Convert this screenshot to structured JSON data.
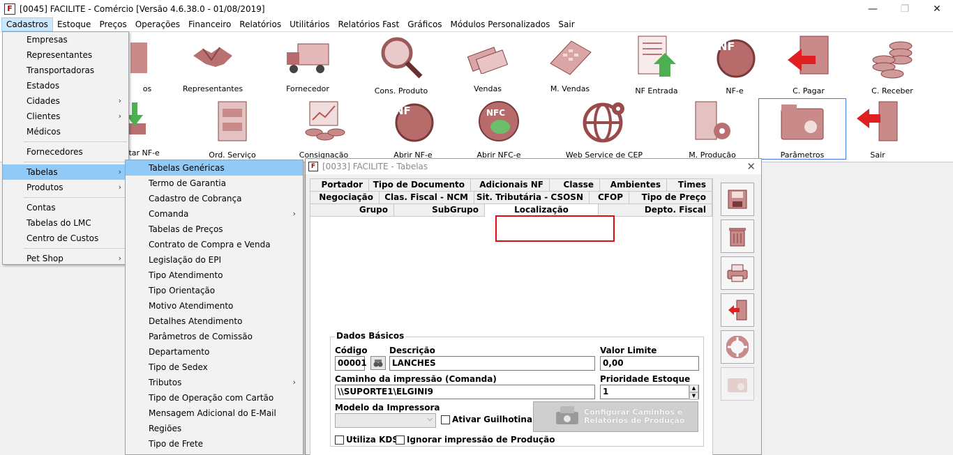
{
  "window": {
    "title": "[0045] FACILITE - Comércio [Versão 4.6.38.0 - 01/08/2019]",
    "app_icon": "F",
    "minimize": "—",
    "maximize": "❐",
    "close": "✕"
  },
  "menubar": [
    "Cadastros",
    "Estoque",
    "Preços",
    "Operações",
    "Financeiro",
    "Relatórios",
    "Utilitários",
    "Relatórios Fast",
    "Gráficos",
    "Módulos Personalizados",
    "Sair"
  ],
  "toolbar": {
    "row1": [
      "os",
      "Representantes",
      "Fornecedor",
      "Cons. Produto",
      "Vendas",
      "M. Vendas",
      "NF Entrada",
      "NF-e",
      "C. Pagar",
      "C. Receber"
    ],
    "row2": [
      "ortar NF-e",
      "Ord. Serviço",
      "Consignação",
      "Abrir NF-e",
      "Abrir NFC-e",
      "Web Service de CEP",
      "M. Produção",
      "Parâmetros",
      "Sair"
    ],
    "nfe_icon_text": "NF",
    "nfce_icon_text": "NFC"
  },
  "cadastros_menu": {
    "items": [
      {
        "label": "Empresas",
        "sub": false
      },
      {
        "label": "Representantes",
        "sub": false
      },
      {
        "label": "Transportadoras",
        "sub": false
      },
      {
        "label": "Estados",
        "sub": false
      },
      {
        "label": "Cidades",
        "sub": true
      },
      {
        "label": "Clientes",
        "sub": true
      },
      {
        "label": "Médicos",
        "sub": false
      },
      {
        "label": "Fornecedores",
        "sub": false
      },
      {
        "label": "Tabelas",
        "sub": true
      },
      {
        "label": "Produtos",
        "sub": true
      },
      {
        "label": "Contas",
        "sub": false
      },
      {
        "label": "Tabelas do LMC",
        "sub": false
      },
      {
        "label": "Centro de Custos",
        "sub": false
      },
      {
        "label": "Pet Shop",
        "sub": true
      }
    ],
    "submenu_arrow": "›"
  },
  "tabelas_menu": {
    "items": [
      {
        "label": "Tabelas Genéricas",
        "sub": false
      },
      {
        "label": "Termo de Garantia",
        "sub": false
      },
      {
        "label": "Cadastro de Cobrança",
        "sub": false
      },
      {
        "label": "Comanda",
        "sub": true
      },
      {
        "label": "Tabelas de Preços",
        "sub": false
      },
      {
        "label": "Contrato de Compra e Venda",
        "sub": false
      },
      {
        "label": "Legislação do EPI",
        "sub": false
      },
      {
        "label": "Tipo Atendimento",
        "sub": false
      },
      {
        "label": "Tipo Orientação",
        "sub": false
      },
      {
        "label": "Motivo Atendimento",
        "sub": false
      },
      {
        "label": "Detalhes Atendimento",
        "sub": false
      },
      {
        "label": "Parâmetros de Comissão",
        "sub": false
      },
      {
        "label": "Departamento",
        "sub": false
      },
      {
        "label": "Tipo de Sedex",
        "sub": false
      },
      {
        "label": "Tributos",
        "sub": true
      },
      {
        "label": "Tipo de Operação com Cartão",
        "sub": false
      },
      {
        "label": "Mensagem Adicional do E-Mail",
        "sub": false
      },
      {
        "label": "Regiões",
        "sub": false
      },
      {
        "label": "Tipo de Frete",
        "sub": false
      }
    ]
  },
  "dialog": {
    "title": "[0033] FACILITE - Tabelas",
    "close": "✕",
    "tabs_row1": [
      "Portador",
      "Tipo de Documento",
      "Adicionais NF",
      "Classe",
      "Ambientes",
      "Times"
    ],
    "tabs_row2": [
      "Negociação",
      "Clas. Fiscal - NCM",
      "Sit. Tributária - CSOSN",
      "CFOP",
      "Tipo de Preço"
    ],
    "tabs_row3": [
      "Grupo",
      "SubGrupo",
      "Localização",
      "Depto. Fiscal"
    ],
    "group_title": "Dados Básicos",
    "labels": {
      "codigo": "Código",
      "descricao": "Descrição",
      "valor_limite": "Valor Limite",
      "caminho": "Caminho da impressão (Comanda)",
      "prioridade": "Prioridade Estoque Lote",
      "modelo": "Modelo da Impressora"
    },
    "values": {
      "codigo": "00001",
      "descricao": "LANCHES",
      "valor_limite": "0,00",
      "caminho": "\\\\SUPORTE1\\ELGINI9",
      "prioridade": "1",
      "modelo": ""
    },
    "checkboxes": {
      "guilhotina": "Ativar Guilhotina",
      "kds": "Utiliza KDS",
      "ignorar": "Ignorar impressão de Produção"
    },
    "config_button": {
      "line1": "Configurar Caminhos e",
      "line2": "Relatórios de Produção"
    },
    "spin_up": "▲",
    "spin_down": "▼",
    "combo_arrow": "⌵"
  }
}
